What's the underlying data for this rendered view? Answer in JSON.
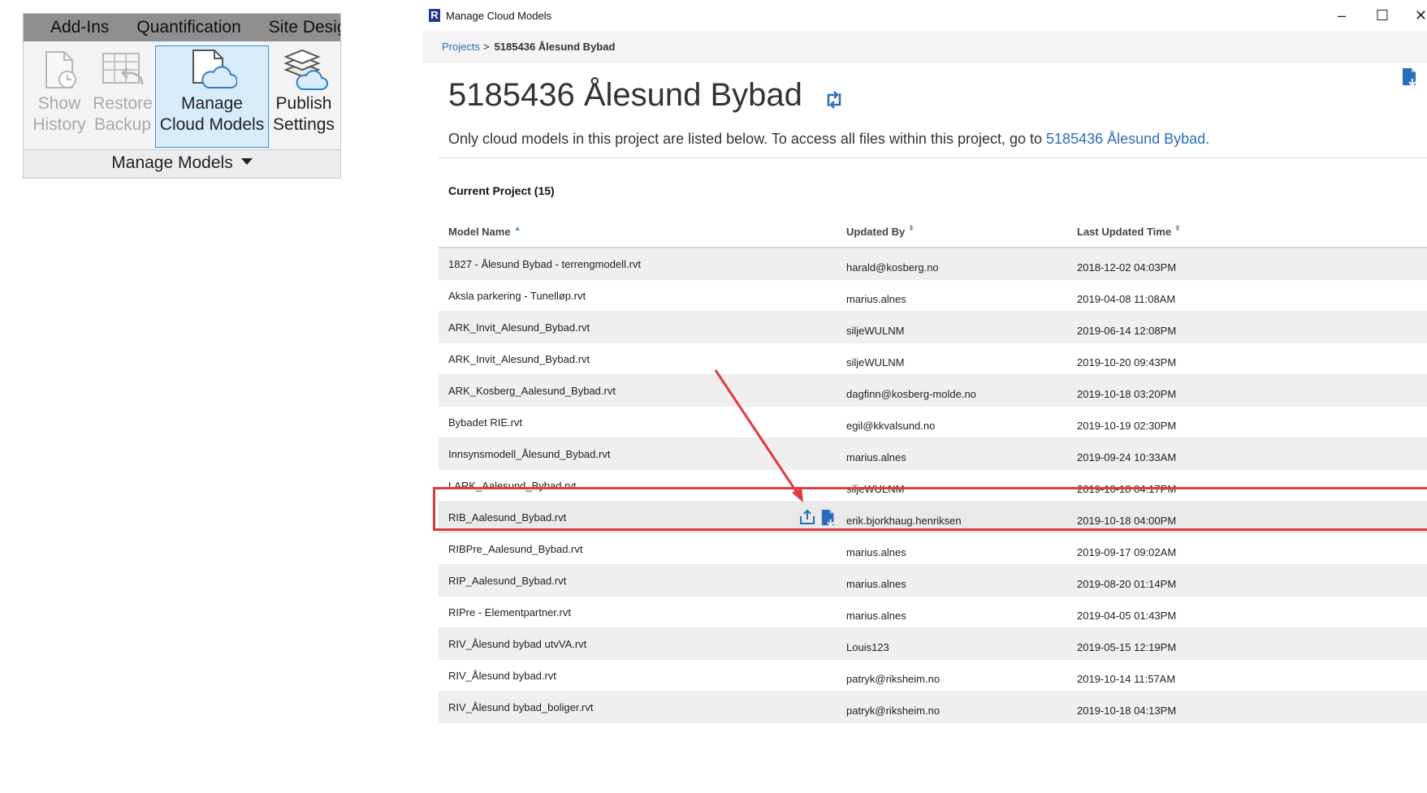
{
  "ribbon": {
    "tabs": [
      "Add-Ins",
      "Quantification",
      "Site Desig"
    ],
    "buttons": [
      {
        "line1": "Show",
        "line2": "History",
        "icon": "show-history-icon",
        "enabled": false
      },
      {
        "line1": "Restore",
        "line2": "Backup",
        "icon": "restore-backup-icon",
        "enabled": false
      },
      {
        "line1": "Manage",
        "line2": "Cloud Models",
        "icon": "manage-cloud-models-icon",
        "enabled": true
      },
      {
        "line1": "Publish",
        "line2": "Settings",
        "icon": "publish-settings-icon",
        "enabled": true
      }
    ],
    "panel_title": "Manage Models"
  },
  "window": {
    "app_icon": "R",
    "title": "Manage Cloud Models",
    "controls": [
      "–",
      "☐",
      "✕"
    ]
  },
  "breadcrumb": {
    "link": "Projects",
    "separator": ">",
    "current": "5185436 Ålesund Bybad"
  },
  "page": {
    "title": "5185436 Ålesund Bybad",
    "info_text": "Only cloud models in this project are listed below. To access all files within this project, go to ",
    "info_link": "5185436 Ålesund Bybad",
    "info_suffix": ".",
    "section_title": "Current Project (15)"
  },
  "table": {
    "columns": [
      "Model Name",
      "Updated By",
      "Last Updated Time"
    ],
    "rows": [
      {
        "name": "1827 - Ålesund Bybad - terrengmodell.rvt",
        "user": "harald@kosberg.no",
        "time": "2018-12-02 04:03PM"
      },
      {
        "name": "Aksla parkering - Tunelløp.rvt",
        "user": "marius.alnes",
        "time": "2019-04-08 11:08AM"
      },
      {
        "name": "ARK_Invit_Alesund_Bybad.rvt",
        "user": "siljeWULNM",
        "time": "2019-06-14 12:08PM"
      },
      {
        "name": "ARK_Invit_Alesund_Bybad.rvt",
        "user": "siljeWULNM",
        "time": "2019-10-20 09:43PM"
      },
      {
        "name": "ARK_Kosberg_Aalesund_Bybad.rvt",
        "user": "dagfinn@kosberg-molde.no",
        "time": "2019-10-18 03:20PM"
      },
      {
        "name": "Bybadet RIE.rvt",
        "user": "egil@kkvalsund.no",
        "time": "2019-10-19 02:30PM"
      },
      {
        "name": "Innsynsmodell_Ålesund_Bybad.rvt",
        "user": "marius.alnes",
        "time": "2019-09-24 10:33AM"
      },
      {
        "name": "LARK_Aalesund_Bybad.rvt",
        "user": "siljeWULNM",
        "time": "2019-10-18 04:17PM"
      },
      {
        "name": "RIB_Aalesund_Bybad.rvt",
        "user": "erik.bjorkhaug.henriksen",
        "time": "2019-10-18 04:00PM"
      },
      {
        "name": "RIBPre_Aalesund_Bybad.rvt",
        "user": "marius.alnes",
        "time": "2019-09-17 09:02AM"
      },
      {
        "name": "RIP_Aalesund_Bybad.rvt",
        "user": "marius.alnes",
        "time": "2019-08-20 01:14PM"
      },
      {
        "name": "RIPre - Elementpartner.rvt",
        "user": "marius.alnes",
        "time": "2019-04-05 01:43PM"
      },
      {
        "name": "RIV_Ålesund bybad utvVA.rvt",
        "user": "Louis123",
        "time": "2019-05-15 12:19PM"
      },
      {
        "name": "RIV_Ålesund bybad.rvt",
        "user": "patryk@riksheim.no",
        "time": "2019-10-14 11:57AM"
      },
      {
        "name": "RIV_Ålesund bybad_boliger.rvt",
        "user": "patryk@riksheim.no",
        "time": "2019-10-18 04:13PM"
      }
    ],
    "highlighted_row": 8,
    "row_action_icons": [
      "publish-upload-icon",
      "file-download-icon"
    ]
  },
  "annotation": {
    "color": "#e0393e"
  },
  "colors": {
    "link": "#2a6ebb",
    "active_button_bg": "#d6ecfb",
    "active_button_border": "#3a8fd8"
  }
}
